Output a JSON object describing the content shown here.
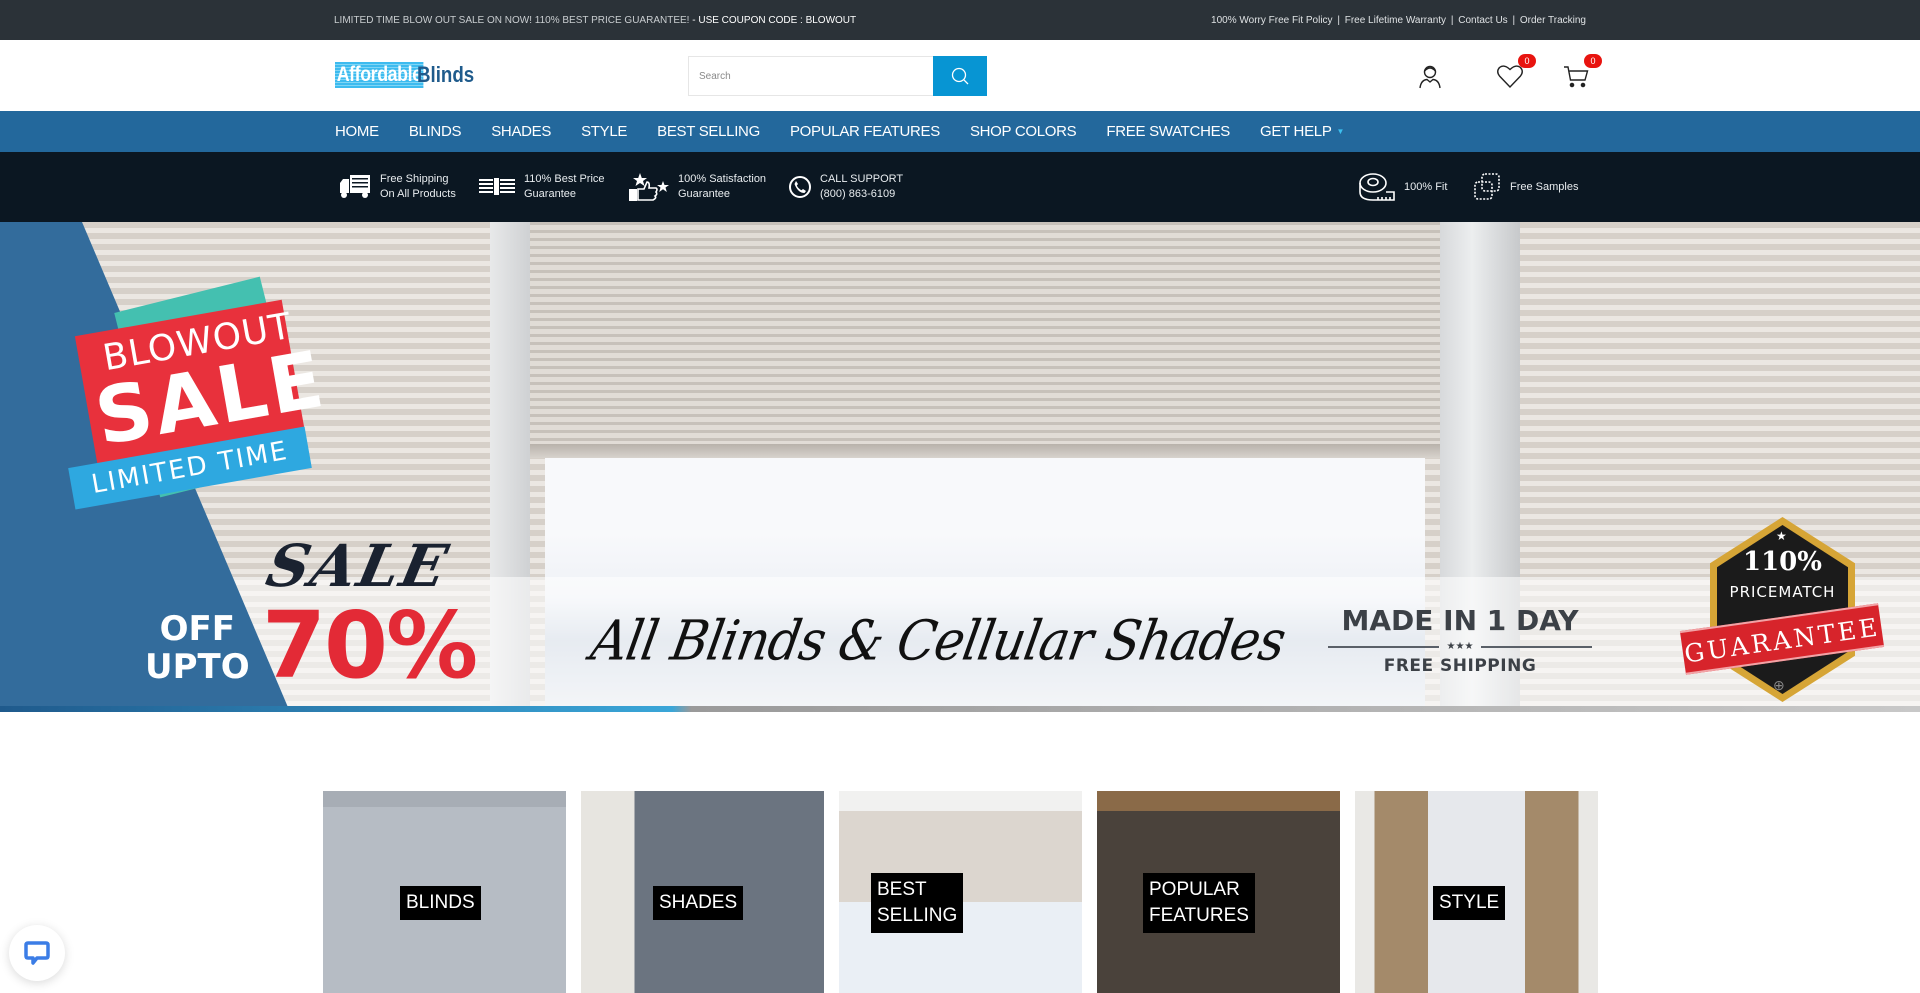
{
  "topbar": {
    "promo": "LIMITED TIME BLOW OUT SALE ON NOW! 110% BEST PRICE GUARANTEE!",
    "promo_separator": " - ",
    "coupon": "USE COUPON CODE : BLOWOUT",
    "links": [
      "100% Worry Free Fit Policy",
      "Free Lifetime Warranty",
      "Contact Us",
      "Order Tracking"
    ],
    "link_separator": "|"
  },
  "header": {
    "logo_part1": "Affordable",
    "logo_part2": "Blinds",
    "search_placeholder": "Search",
    "search_value": "",
    "wishlist_count": "0",
    "cart_count": "0",
    "icons": [
      "user-icon",
      "heart-icon",
      "cart-icon",
      "search-icon"
    ]
  },
  "nav": {
    "items": [
      {
        "label": "HOME"
      },
      {
        "label": "BLINDS"
      },
      {
        "label": "SHADES"
      },
      {
        "label": "STYLE"
      },
      {
        "label": "BEST SELLING"
      },
      {
        "label": "POPULAR FEATURES"
      },
      {
        "label": "SHOP COLORS"
      },
      {
        "label": "FREE SWATCHES"
      },
      {
        "label": "GET HELP",
        "dropdown": true
      }
    ],
    "caret": "▼"
  },
  "features": [
    {
      "icon": "truck-icon",
      "line1": "Free Shipping",
      "line2": "On All Products"
    },
    {
      "icon": "cash-icon",
      "line1": "110% Best Price",
      "line2": "Guarantee"
    },
    {
      "icon": "thumbs-up-icon",
      "line1": "100% Satisfaction",
      "line2": "Guarantee"
    },
    {
      "icon": "phone-icon",
      "line1": "CALL SUPPORT",
      "line2": "(800) 863-6109"
    },
    {
      "icon": "tape-measure-icon",
      "line1": "100% Fit"
    },
    {
      "icon": "swatch-icon",
      "line1": "Free Samples"
    }
  ],
  "hero": {
    "badge_line1": "BLOWOUT",
    "badge_line2": "SALE",
    "badge_line3": "LIMITED TIME",
    "sale_script": "SALE",
    "off": "OFF",
    "upto": "UPTO",
    "percent": "70%",
    "headline": "All Blinds &  Cellular Shades",
    "made_line1": "MADE IN 1 DAY",
    "made_stars": "★★★",
    "made_line2": "FREE SHIPPING",
    "pricematch_pct": "110%",
    "pricematch_label": "PRICEMATCH",
    "pricematch_ribbon": "GUARANTEE"
  },
  "categories": [
    {
      "line1": "BLINDS",
      "line2": ""
    },
    {
      "line1": "SHADES",
      "line2": ""
    },
    {
      "line1": "BEST",
      "line2": "SELLING"
    },
    {
      "line1": "POPULAR",
      "line2": "FEATURES"
    },
    {
      "line1": "STYLE",
      "line2": ""
    }
  ],
  "colors": {
    "topbar_bg": "#2b3238",
    "nav_bg": "#23689c",
    "features_bg": "#0b1722",
    "search_button": "#0795d3",
    "badge": "#e8140f",
    "chat_icon": "#3b7de6"
  }
}
